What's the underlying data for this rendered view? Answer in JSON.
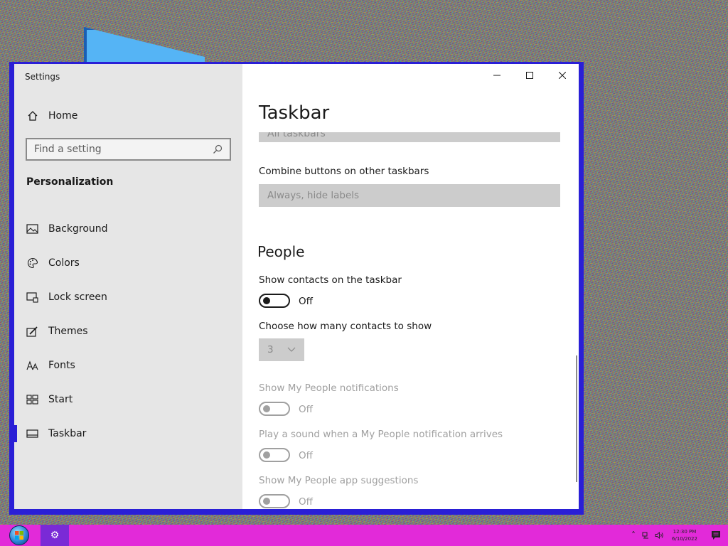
{
  "window": {
    "app_title": "Settings"
  },
  "sidebar": {
    "home_label": "Home",
    "search_placeholder": "Find a setting",
    "section_title": "Personalization",
    "items": [
      {
        "label": "Background",
        "icon": "picture-icon"
      },
      {
        "label": "Colors",
        "icon": "palette-icon"
      },
      {
        "label": "Lock screen",
        "icon": "lock-screen-icon"
      },
      {
        "label": "Themes",
        "icon": "themes-brush-icon"
      },
      {
        "label": "Fonts",
        "icon": "fonts-icon"
      },
      {
        "label": "Start",
        "icon": "start-tiles-icon"
      },
      {
        "label": "Taskbar",
        "icon": "taskbar-icon",
        "active": true
      }
    ]
  },
  "main": {
    "page_title": "Taskbar",
    "partial_dropdown_value": "All taskbars",
    "combine_label": "Combine buttons on other taskbars",
    "combine_value": "Always, hide labels",
    "people_heading": "People",
    "show_contacts_label": "Show contacts on the taskbar",
    "show_contacts_state": "Off",
    "contacts_count_label": "Choose how many contacts to show",
    "contacts_count_value": "3",
    "notifications_label": "Show My People notifications",
    "notifications_state": "Off",
    "sound_label": "Play a sound when a My People notification arrives",
    "sound_state": "Off",
    "suggestions_label": "Show My People app suggestions",
    "suggestions_state": "Off"
  },
  "taskbar": {
    "clock_time": "12:30 PM",
    "clock_date": "6/10/2022"
  },
  "colors": {
    "accent": "#2a1fd6",
    "taskbar": "#e22ad9"
  }
}
